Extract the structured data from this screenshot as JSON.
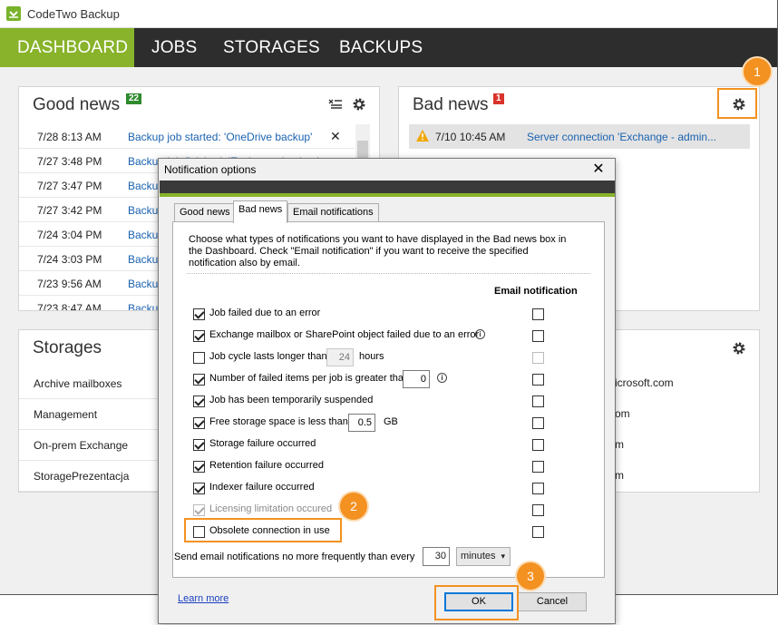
{
  "app": {
    "title": "CodeTwo Backup"
  },
  "nav": {
    "tabs": [
      "DASHBOARD",
      "JOBS",
      "STORAGES",
      "BACKUPS"
    ]
  },
  "good_news": {
    "title": "Good news",
    "count": "22",
    "rows": [
      {
        "date": "7/28 8:13 AM",
        "msg": "Backup job started: 'OneDrive backup'"
      },
      {
        "date": "7/27 3:48 PM",
        "msg": "Backup job finished: 'Exchange backup'"
      },
      {
        "date": "7/27 3:47 PM",
        "msg": "Backup"
      },
      {
        "date": "7/27 3:42 PM",
        "msg": "Backup"
      },
      {
        "date": "7/24 3:04 PM",
        "msg": "Backup"
      },
      {
        "date": "7/24 3:03 PM",
        "msg": "Backup"
      },
      {
        "date": "7/23 9:56 AM",
        "msg": "Backup"
      },
      {
        "date": "7/23 8:47 AM",
        "msg": "Backup"
      }
    ]
  },
  "bad_news": {
    "title": "Bad news",
    "count": "1",
    "rows": [
      {
        "date": "7/10 10:45 AM",
        "msg": "Server connection 'Exchange - admin..."
      }
    ]
  },
  "storages": {
    "title": "Storages",
    "rows": [
      "Archive mailboxes",
      "Management",
      "On-prem Exchange",
      "StoragePrezentacja"
    ]
  },
  "right_panel": {
    "rows": [
      "icrosoft.com",
      "om",
      "m",
      "m"
    ]
  },
  "dialog": {
    "title": "Notification options",
    "tabs": [
      "Good news",
      "Bad news",
      "Email notifications"
    ],
    "active_tab": "Bad news",
    "description": "Choose what types of notifications you want to have displayed in the Bad news box in the Dashboard. Check \"Email notification\" if you want to receive the specified notification also by email.",
    "email_header": "Email notification",
    "options": [
      {
        "label": "Job failed due to an error",
        "checked": true,
        "email": false
      },
      {
        "label": "Exchange mailbox or SharePoint object failed due to an error",
        "checked": true,
        "email": false,
        "info": true
      },
      {
        "label": "Job cycle lasts longer than",
        "checked": false,
        "email": false,
        "value": "24",
        "unit": "hours",
        "value_disabled": true,
        "email_disabled": true
      },
      {
        "label": "Number of failed items per job is greater than",
        "checked": true,
        "email": false,
        "value": "0",
        "info": true
      },
      {
        "label": "Job has been temporarily suspended",
        "checked": true,
        "email": false
      },
      {
        "label": "Free storage space is less than",
        "checked": true,
        "email": false,
        "value": "0.5",
        "unit": "GB"
      },
      {
        "label": "Storage failure occurred",
        "checked": true,
        "email": false
      },
      {
        "label": "Retention failure occurred",
        "checked": true,
        "email": false
      },
      {
        "label": "Indexer failure occurred",
        "checked": true,
        "email": false
      },
      {
        "label": "Licensing limitation occured",
        "checked": true,
        "email": false,
        "disabled": true
      },
      {
        "label": "Obsolete connection in use",
        "checked": false,
        "email": false
      }
    ],
    "frequency_label": "Send email notifications no more frequently than every",
    "frequency_value": "30",
    "frequency_unit": "minutes",
    "learn_more": "Learn more",
    "ok": "OK",
    "cancel": "Cancel"
  },
  "callouts": [
    "1",
    "2",
    "3"
  ],
  "colors": {
    "accent": "#88b32a",
    "nav_bg": "#2d2d2d",
    "callout": "#f39121",
    "link": "#1a62b0"
  }
}
